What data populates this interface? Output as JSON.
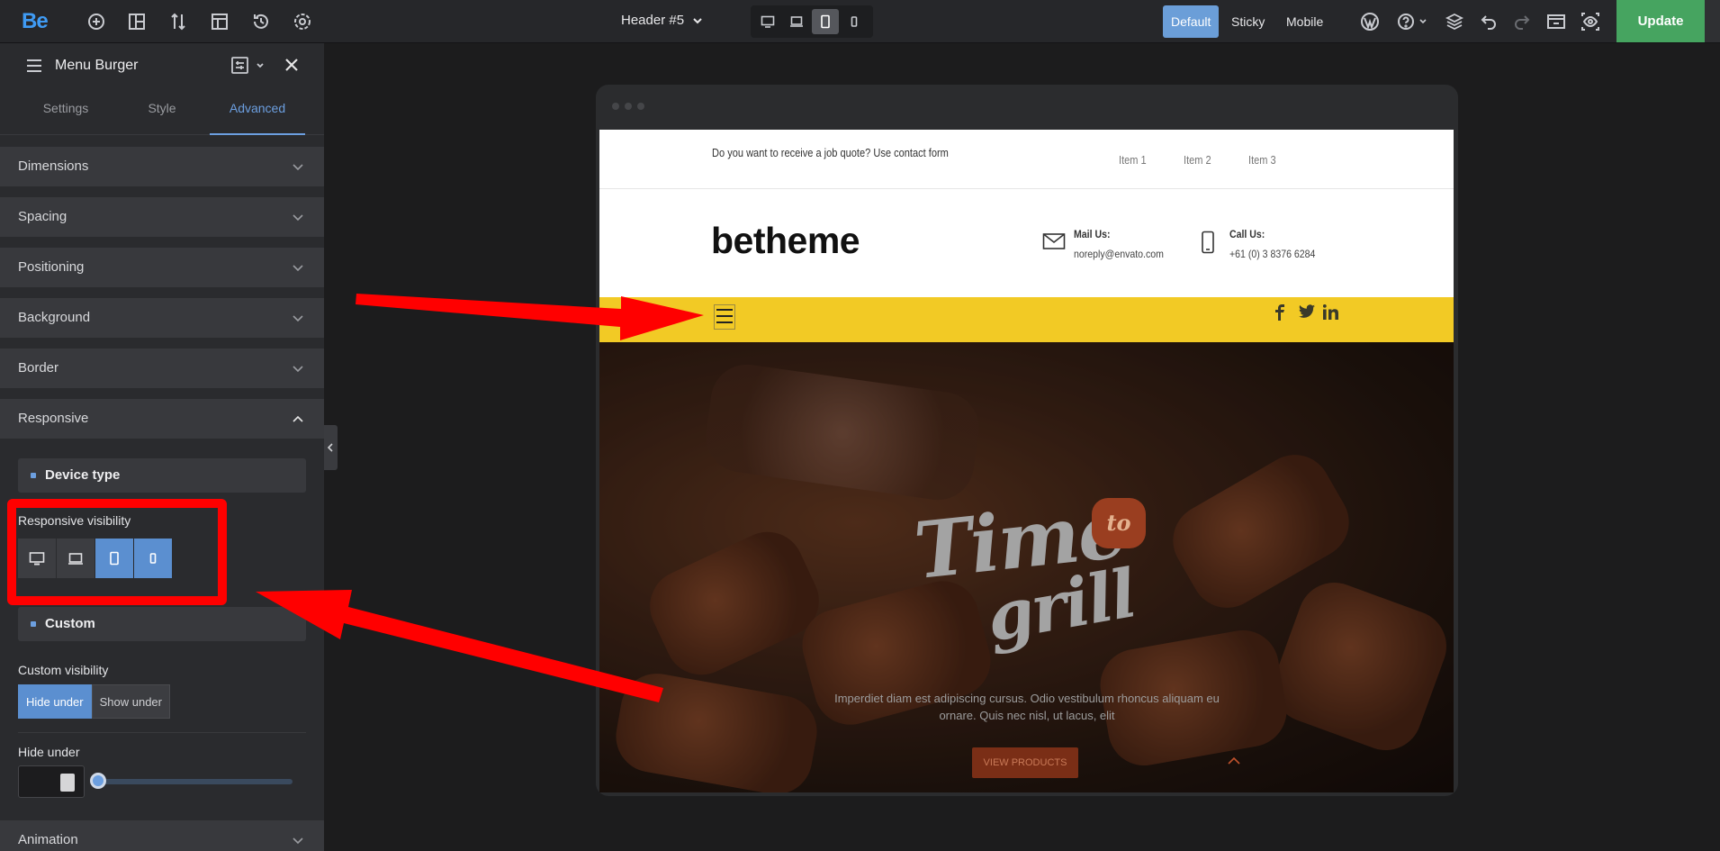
{
  "topbar": {
    "logo": "Be",
    "header_title": "Header #5",
    "modes": [
      "Default",
      "Sticky",
      "Mobile"
    ],
    "update_label": "Update"
  },
  "sidebar": {
    "title": "Menu Burger",
    "tabs": [
      "Settings",
      "Style",
      "Advanced"
    ],
    "sections": [
      "Dimensions",
      "Spacing",
      "Positioning",
      "Background",
      "Border",
      "Responsive",
      "Animation"
    ],
    "device_type": "Device type",
    "responsive_visibility": "Responsive visibility",
    "custom": "Custom",
    "custom_visibility": "Custom visibility",
    "custom_options": [
      "Hide under",
      "Show under"
    ],
    "hide_under": "Hide under"
  },
  "site": {
    "quote": "Do you want to receive a job quote? Use contact form",
    "menu": [
      "Item 1",
      "Item 2",
      "Item 3"
    ],
    "brand": "betheme",
    "mail_title": "Mail Us:",
    "mail_value": "noreply@envato.com",
    "call_title": "Call Us:",
    "call_value": "+61 (0) 3 8376 6284",
    "hero_logo_time": "Time",
    "hero_logo_to": "to",
    "hero_logo_grill": "grill",
    "hero_text": "Imperdiet diam est adipiscing cursus. Odio vestibulum rhoncus aliquam eu ornare. Quis nec nisl, ut lacus, elit",
    "hero_button": "VIEW PRODUCTS"
  }
}
